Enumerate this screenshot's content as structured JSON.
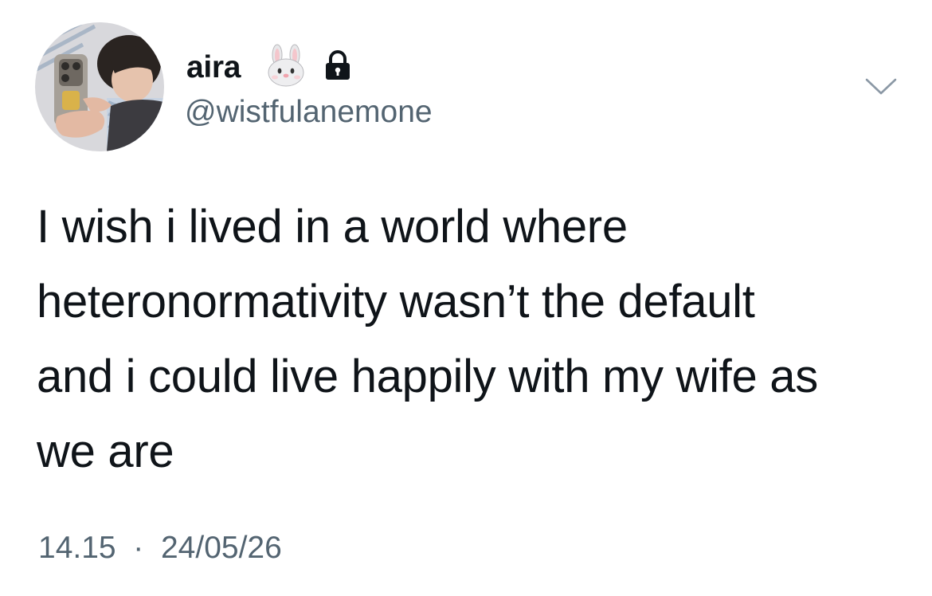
{
  "author": {
    "display_name": "aira",
    "handle": "@wistfulanemone",
    "name_emoji": "rabbit-face-icon",
    "protected_icon": "lock-icon"
  },
  "tweet": {
    "lines": [
      "I wish i lived in a world where",
      "heteronormativity wasn’t the default",
      "and i could live happily with my wife as",
      "we are"
    ]
  },
  "meta": {
    "time": "14.15",
    "separator": "·",
    "date": "24/05/26"
  },
  "menu_icon": "chevron-down-icon",
  "colors": {
    "text": "#0f1419",
    "secondary_text": "#536471",
    "background": "#ffffff"
  }
}
